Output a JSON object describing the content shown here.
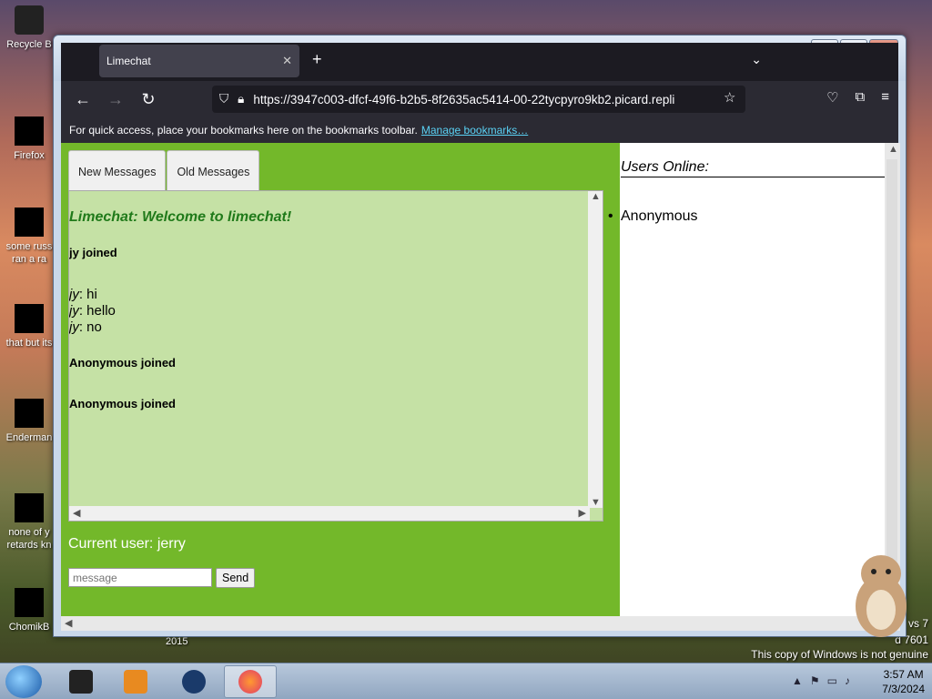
{
  "desktop": {
    "icons": [
      {
        "label1": "Recycle B",
        "label2": ""
      },
      {
        "label1": "Firefox",
        "label2": ""
      },
      {
        "label1": "some russ",
        "label2": "ran a ra"
      },
      {
        "label1": "that but its",
        "label2": ""
      },
      {
        "label1": "Enderman",
        "label2": ""
      },
      {
        "label1": "none of y",
        "label2": "retards kn"
      },
      {
        "label1": "ChomikB",
        "label2": ""
      }
    ],
    "watermark_line1": "vs 7",
    "watermark_line2": "d 7601",
    "watermark_line3": "This copy of Windows is not genuine",
    "year_text": "2015"
  },
  "browser": {
    "tab_title": "Limechat",
    "tab_close": "✕",
    "new_tab": "+",
    "list_tabs": "⌄",
    "url_prefix": "https://",
    "url_rest": "3947c003-dfcf-49f6-b2b5-8f2635ac5414-00-22tycpyro9kb2.picard.repli",
    "bookmark_hint": "For quick access, place your bookmarks here on the bookmarks toolbar.",
    "bookmark_link": "Manage bookmarks…",
    "window_buttons": {
      "minimize": "—",
      "maximize": "▭",
      "close": "✕"
    }
  },
  "chat": {
    "tabs": [
      "New Messages",
      "Old Messages"
    ],
    "welcome": "Limechat: Welcome to limechat!",
    "events": [
      {
        "type": "join",
        "text": "jy joined"
      },
      {
        "type": "messages",
        "items": [
          {
            "user": "jy",
            "text": ": hi"
          },
          {
            "user": "jy",
            "text": ": hello"
          },
          {
            "user": "jy",
            "text": ": no"
          }
        ]
      },
      {
        "type": "join",
        "text": "Anonymous joined"
      },
      {
        "type": "join",
        "text": "Anonymous joined"
      }
    ],
    "current_user": "Current user: jerry",
    "input_placeholder": "message",
    "send_label": "Send"
  },
  "users": {
    "title": "Users Online:",
    "list": [
      "Anonymous"
    ]
  },
  "taskbar": {
    "time": "3:57 AM",
    "date": "7/3/2024"
  }
}
